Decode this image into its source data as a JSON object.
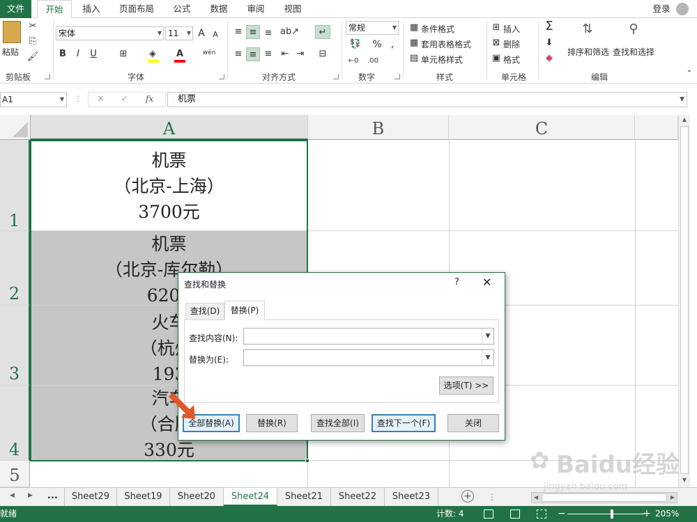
{
  "ribbon_tabs": [
    "文件",
    "开始",
    "插入",
    "页面布局",
    "公式",
    "数据",
    "审阅",
    "视图"
  ],
  "login": "登录",
  "clipboard": {
    "paste": "粘贴",
    "group": "剪贴板"
  },
  "font": {
    "name": "宋体",
    "size": "11",
    "group": "字体",
    "bold": "B",
    "italic": "I",
    "underline": "U",
    "grow": "A",
    "shrink": "A",
    "font_color": "A",
    "phonetic": "wén"
  },
  "alignment": {
    "group": "对齐方式"
  },
  "number": {
    "format": "常规",
    "group": "数字",
    "percent": "%",
    "comma": ","
  },
  "styles": {
    "conditional": "条件格式",
    "table": "套用表格格式",
    "cell_styles": "单元格样式",
    "group": "样式"
  },
  "cells": {
    "insert": "插入",
    "delete": "删除",
    "format": "格式",
    "group": "单元格"
  },
  "editing": {
    "sort": "排序和筛选",
    "find": "查找和选择",
    "group": "编辑",
    "sum": "Σ"
  },
  "formula_bar": {
    "name_box": "A1",
    "content": "机票",
    "fx": "fx"
  },
  "columns": [
    "A",
    "B",
    "C"
  ],
  "rows": [
    "1",
    "2",
    "3",
    "4",
    "5"
  ],
  "cells_A": [
    [
      "机票",
      "（北京-上海）",
      "3700元"
    ],
    [
      "机票",
      "（北京-库尔勒）",
      "6200"
    ],
    [
      "火车",
      "（杭州-",
      "193"
    ],
    [
      "汽车",
      "（合肥-",
      "330元"
    ]
  ],
  "sheet_tabs": [
    "Sheet29",
    "Sheet19",
    "Sheet20",
    "Sheet24",
    "Sheet21",
    "Sheet22",
    "Sheet23"
  ],
  "active_sheet": "Sheet24",
  "sheet_nav": {
    "ellipsis": "..."
  },
  "status": {
    "ready": "就绪",
    "count": "计数: 4",
    "zoom": "205%"
  },
  "dialog": {
    "title": "查找和替换",
    "help": "?",
    "tabs": [
      "查找(D)",
      "替换(P)"
    ],
    "find_label": "查找内容(N):",
    "replace_label": "替换为(E):",
    "find_value": "",
    "replace_value": "",
    "options_button": "选项(T) >>",
    "buttons": [
      "全部替换(A)",
      "替换(R)",
      "查找全部(I)",
      "查找下一个(F)",
      "关闭"
    ]
  },
  "watermark": "Baidu经验",
  "watermark_url": "jingyan.baidu.com",
  "colors": {
    "accent": "#217346",
    "selection_grey": "#c6c6c6",
    "pointer": "#e2572a"
  }
}
